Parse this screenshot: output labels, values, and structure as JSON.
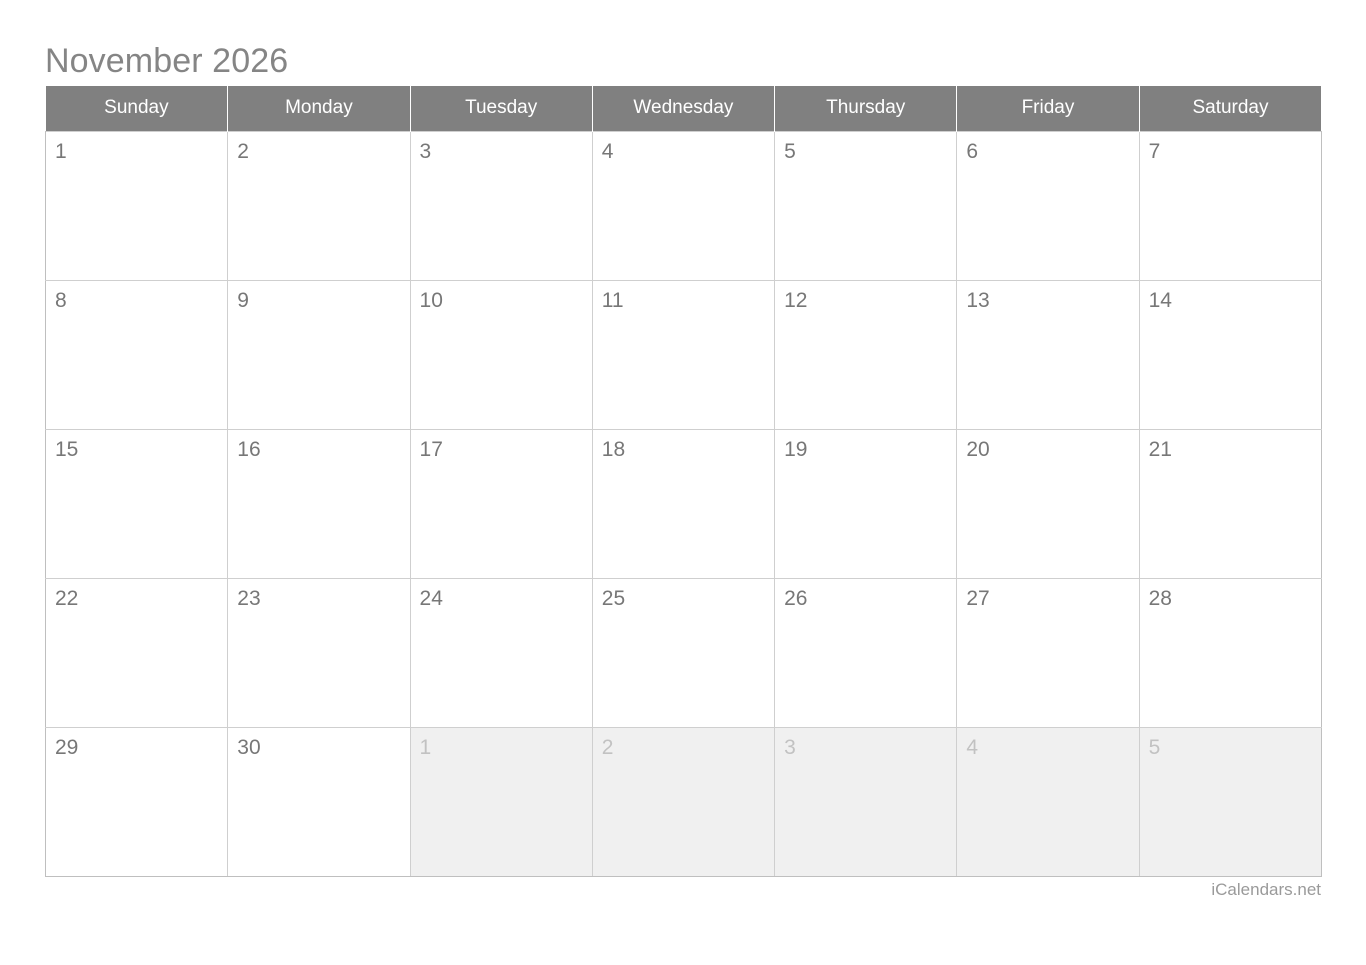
{
  "calendar": {
    "title": "November 2026",
    "month_name": "November",
    "year": "2026",
    "weekday_headers": [
      "Sunday",
      "Monday",
      "Tuesday",
      "Wednesday",
      "Thursday",
      "Friday",
      "Saturday"
    ],
    "weeks": [
      [
        {
          "day": "1",
          "other_month": false
        },
        {
          "day": "2",
          "other_month": false
        },
        {
          "day": "3",
          "other_month": false
        },
        {
          "day": "4",
          "other_month": false
        },
        {
          "day": "5",
          "other_month": false
        },
        {
          "day": "6",
          "other_month": false
        },
        {
          "day": "7",
          "other_month": false
        }
      ],
      [
        {
          "day": "8",
          "other_month": false
        },
        {
          "day": "9",
          "other_month": false
        },
        {
          "day": "10",
          "other_month": false
        },
        {
          "day": "11",
          "other_month": false
        },
        {
          "day": "12",
          "other_month": false
        },
        {
          "day": "13",
          "other_month": false
        },
        {
          "day": "14",
          "other_month": false
        }
      ],
      [
        {
          "day": "15",
          "other_month": false
        },
        {
          "day": "16",
          "other_month": false
        },
        {
          "day": "17",
          "other_month": false
        },
        {
          "day": "18",
          "other_month": false
        },
        {
          "day": "19",
          "other_month": false
        },
        {
          "day": "20",
          "other_month": false
        },
        {
          "day": "21",
          "other_month": false
        }
      ],
      [
        {
          "day": "22",
          "other_month": false
        },
        {
          "day": "23",
          "other_month": false
        },
        {
          "day": "24",
          "other_month": false
        },
        {
          "day": "25",
          "other_month": false
        },
        {
          "day": "26",
          "other_month": false
        },
        {
          "day": "27",
          "other_month": false
        },
        {
          "day": "28",
          "other_month": false
        }
      ],
      [
        {
          "day": "29",
          "other_month": false
        },
        {
          "day": "30",
          "other_month": false
        },
        {
          "day": "1",
          "other_month": true
        },
        {
          "day": "2",
          "other_month": true
        },
        {
          "day": "3",
          "other_month": true
        },
        {
          "day": "4",
          "other_month": true
        },
        {
          "day": "5",
          "other_month": true
        }
      ]
    ]
  },
  "footer": {
    "credit": "iCalendars.net"
  },
  "colors": {
    "header_background": "#808080",
    "header_text": "#ffffff",
    "title_text": "#858585",
    "day_number": "#777777",
    "other_month_background": "#f0f0f0",
    "other_month_day_number": "#c2c2c2",
    "grid_border": "#cfcfcf",
    "page_background": "#ffffff",
    "footer_text": "#9a9a9a"
  }
}
